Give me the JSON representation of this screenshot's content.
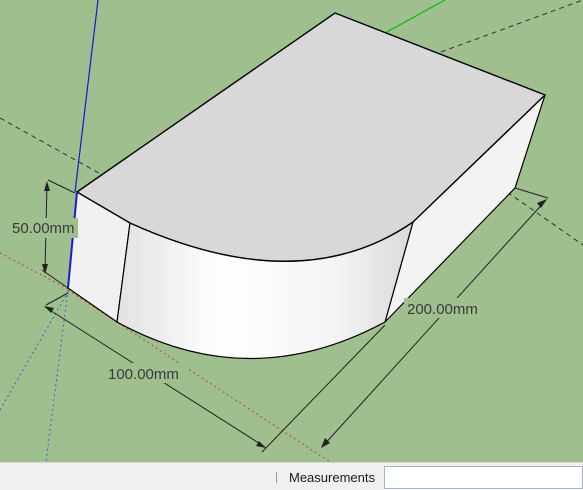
{
  "viewport": {
    "background_color": "#9fbf8f",
    "model": {
      "top_face_color": "#d8d8d8",
      "side_face_color": "#f7f7f7",
      "edge_color": "#000000"
    },
    "axes": {
      "blue_axis_color": "#1a1ad0",
      "green_axis_color": "#00c000",
      "red_axis_color": "#d00000"
    },
    "dimensions": {
      "height_label": "50.00mm",
      "width_label": "100.00mm",
      "length_label": "200.00mm"
    }
  },
  "statusbar": {
    "measurements_label": "Measurements",
    "measurements_value": ""
  }
}
